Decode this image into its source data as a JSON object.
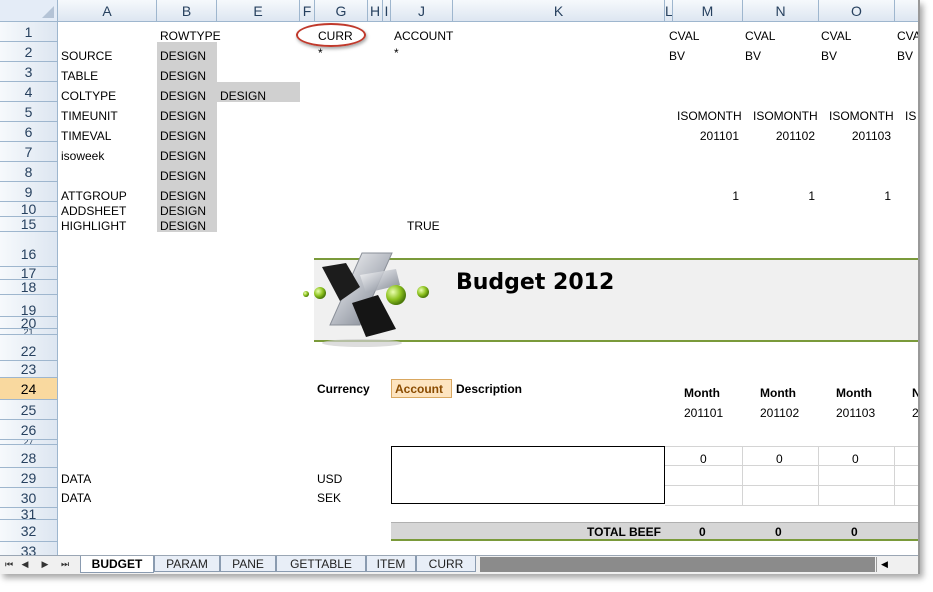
{
  "columns": [
    {
      "label": "A",
      "w": 0
    },
    {
      "label": "B"
    },
    {
      "label": "E"
    },
    {
      "label": "F"
    },
    {
      "label": "G"
    },
    {
      "label": "H"
    },
    {
      "label": "I"
    },
    {
      "label": "J"
    },
    {
      "label": "K"
    },
    {
      "label": "L"
    },
    {
      "label": "M"
    },
    {
      "label": "N"
    },
    {
      "label": "O"
    }
  ],
  "rows": [
    "1",
    "2",
    "3",
    "4",
    "5",
    "6",
    "7",
    "8",
    "9",
    "10",
    "15",
    "16",
    "17",
    "18",
    "19",
    "20",
    "21",
    "22",
    "23",
    "24",
    "25",
    "26",
    "27",
    "28",
    "29",
    "30",
    "31",
    "32",
    "33"
  ],
  "selected_row": "24",
  "cells": {
    "b1": "ROWTYPE",
    "g1": "CURR",
    "j1": "ACCOUNT",
    "m1": "CVAL",
    "n1": "CVAL",
    "o1": "CVAL",
    "p1": "CVA",
    "a2": "SOURCE",
    "b2": "DESIGN",
    "g2": "*",
    "j2": "*",
    "m2": "BV",
    "n2": "BV",
    "o2": "BV",
    "p2": "BV",
    "a3": "TABLE",
    "b3": "DESIGN",
    "a4": "COLTYPE",
    "b4": "DESIGN",
    "e4": "DESIGN",
    "a5": "TIMEUNIT",
    "b5": "DESIGN",
    "m5": "ISOMONTH",
    "n5": "ISOMONTH",
    "o5": "ISOMONTH",
    "p5": "IS",
    "a6": "TIMEVAL",
    "b6": "DESIGN",
    "m6": "201101",
    "n6": "201102",
    "o6": "201103",
    "a7": "isoweek",
    "b7": "DESIGN",
    "b8": "DESIGN",
    "a9": "ATTGROUP",
    "b9": "DESIGN",
    "m9": "1",
    "n9": "1",
    "o9": "1",
    "a10": "ADDSHEET",
    "b10": "DESIGN",
    "a15": "HIGHLIGHT",
    "b15": "DESIGN",
    "j15": "TRUE"
  },
  "banner": {
    "title": "Budget 2012"
  },
  "headers": {
    "currency": "Currency",
    "account": "Account",
    "description": "Description",
    "month_label": "Month",
    "month_partial": "N",
    "months": [
      "201101",
      "201102",
      "201103"
    ],
    "month_partial_val": "2"
  },
  "data_rows": [
    {
      "a": "DATA",
      "g": "USD"
    },
    {
      "a": "DATA",
      "g": "SEK"
    }
  ],
  "row28_values": [
    "0",
    "0",
    "0"
  ],
  "total": {
    "label": "TOTAL BEEF",
    "values": [
      "0",
      "0",
      "0"
    ]
  },
  "tabs": [
    {
      "label": "BUDGET",
      "active": true
    },
    {
      "label": "PARAM",
      "active": false
    },
    {
      "label": "PANE",
      "active": false
    },
    {
      "label": "GETTABLE",
      "active": false
    },
    {
      "label": "ITEM",
      "active": false
    },
    {
      "label": "CURR",
      "active": false
    }
  ],
  "tab_nav": [
    "first-sheet-icon",
    "prev-sheet-icon",
    "next-sheet-icon",
    "last-sheet-icon"
  ],
  "colors": {
    "accent_green": "#7a9a3a",
    "design_gray": "#d0d0d0",
    "selected_row": "#f9d99f",
    "oval_red": "#c0392b"
  }
}
